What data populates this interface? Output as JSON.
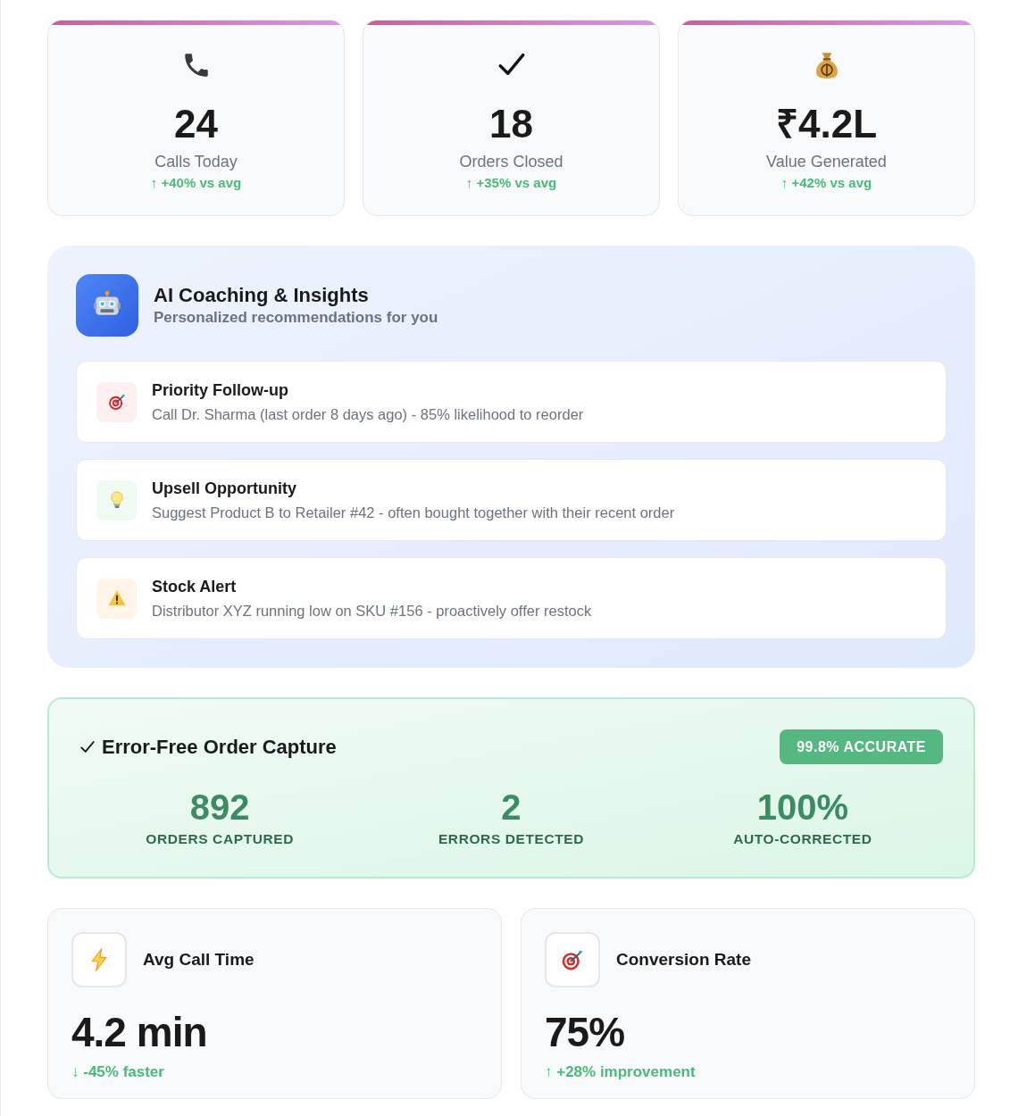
{
  "stat_cards": [
    {
      "kind": "phone",
      "value": "24",
      "label": "Calls Today",
      "trend": "↑ +40% vs avg"
    },
    {
      "kind": "check",
      "value": "18",
      "label": "Orders Closed",
      "trend": "↑ +35% vs avg"
    },
    {
      "kind": "money",
      "value": "₹4.2L",
      "label": "Value Generated",
      "trend": "↑ +42% vs avg"
    }
  ],
  "ai_coaching": {
    "title": "AI Coaching & Insights",
    "subtitle": "Personalized recommendations for you",
    "insights": [
      {
        "kind": "priority",
        "title": "Priority Follow-up",
        "description": "Call Dr. Sharma (last order 8 days ago) - 85% likelihood to reorder"
      },
      {
        "kind": "upsell",
        "title": "Upsell Opportunity",
        "description": "Suggest Product B to Retailer #42 - often bought together with their recent order"
      },
      {
        "kind": "alert",
        "title": "Stock Alert",
        "description": "Distributor XYZ running low on SKU #156 - proactively offer restock"
      }
    ]
  },
  "order_capture": {
    "title": "Error-Free Order Capture",
    "badge": "99.8% ACCURATE",
    "stats": [
      {
        "value": "892",
        "label": "ORDERS CAPTURED"
      },
      {
        "value": "2",
        "label": "ERRORS DETECTED"
      },
      {
        "value": "100%",
        "label": "AUTO-CORRECTED"
      }
    ]
  },
  "metric_cards": [
    {
      "kind": "speed",
      "title": "Avg Call Time",
      "value": "4.2 min",
      "trend": "↓ -45% faster"
    },
    {
      "kind": "conversion",
      "title": "Conversion Rate",
      "value": "75%",
      "trend": "↑ +28% improvement"
    }
  ]
}
